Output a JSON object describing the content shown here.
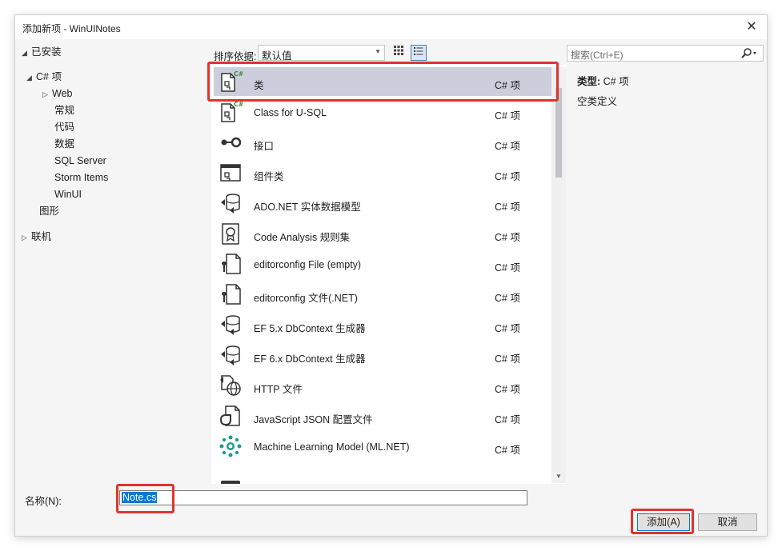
{
  "window": {
    "title": "添加新项 - WinUINotes",
    "close_glyph": "✕"
  },
  "tree": {
    "installed": "已安装",
    "csharp": "C# 项",
    "web": "Web",
    "general": "常规",
    "code": "代码",
    "data": "数据",
    "sql_server": "SQL Server",
    "storm_items": "Storm Items",
    "winui": "WinUI",
    "graphics": "图形",
    "online": "联机"
  },
  "toolbar": {
    "sort_label": "排序依据:",
    "sort_value": "默认值"
  },
  "templates": [
    {
      "name": "类",
      "lang": "C# 项",
      "icon": "csharp-class-icon",
      "selected": true
    },
    {
      "name": "Class for U-SQL",
      "lang": "C# 项",
      "icon": "csharp-class-icon"
    },
    {
      "name": "接口",
      "lang": "C# 项",
      "icon": "interface-icon"
    },
    {
      "name": "组件类",
      "lang": "C# 项",
      "icon": "component-class-icon"
    },
    {
      "name": "ADO.NET 实体数据模型",
      "lang": "C# 项",
      "icon": "data-model-icon"
    },
    {
      "name": "Code Analysis 规则集",
      "lang": "C# 项",
      "icon": "ruleset-icon"
    },
    {
      "name": "editorconfig File (empty)",
      "lang": "C# 项",
      "icon": "editorconfig-icon"
    },
    {
      "name": "editorconfig 文件(.NET)",
      "lang": "C# 项",
      "icon": "editorconfig-icon"
    },
    {
      "name": "EF 5.x DbContext 生成器",
      "lang": "C# 项",
      "icon": "data-model-icon"
    },
    {
      "name": "EF 6.x DbContext 生成器",
      "lang": "C# 项",
      "icon": "data-model-icon"
    },
    {
      "name": "HTTP 文件",
      "lang": "C# 项",
      "icon": "http-file-icon"
    },
    {
      "name": "JavaScript JSON 配置文件",
      "lang": "C# 项",
      "icon": "json-config-icon"
    },
    {
      "name": "Machine Learning Model (ML.NET)",
      "lang": "C# 项",
      "icon": "ml-model-icon"
    }
  ],
  "search": {
    "placeholder": "搜索(Ctrl+E)"
  },
  "info": {
    "type_label": "类型:",
    "type_value": "C# 项",
    "description": "空类定义"
  },
  "name_field": {
    "label": "名称(N):",
    "value": "Note.cs"
  },
  "buttons": {
    "add": "添加(A)",
    "cancel": "取消"
  },
  "colors": {
    "highlight_red": "#e0342f",
    "selection": "#cccedb",
    "accent": "#0078d7"
  }
}
